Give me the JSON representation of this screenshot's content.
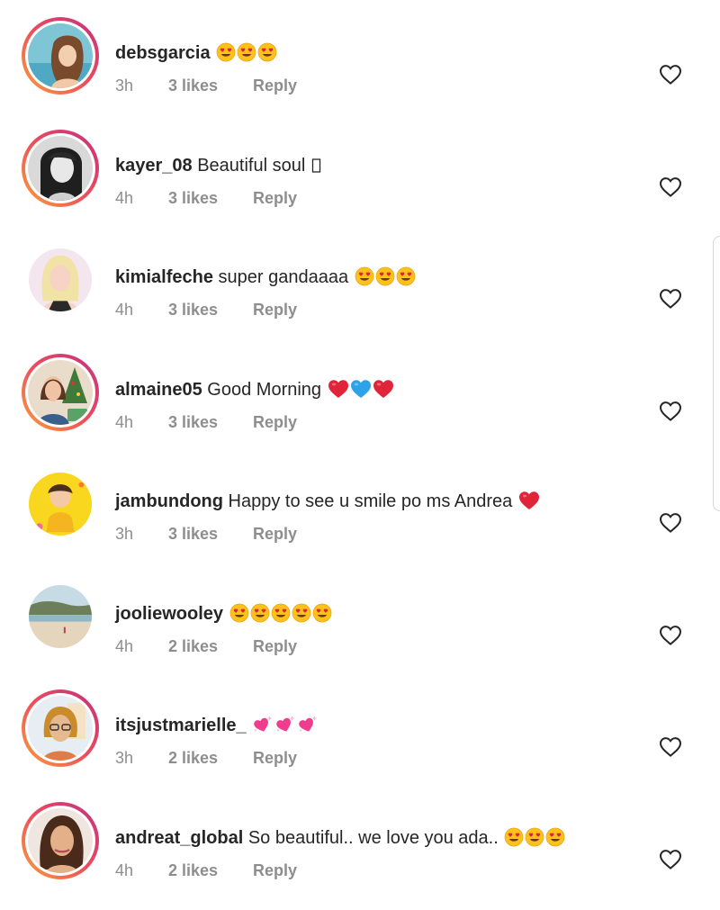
{
  "comments": [
    {
      "username": "debsgarcia",
      "text": "",
      "emoji": [
        "heart-eyes",
        "heart-eyes",
        "heart-eyes"
      ],
      "time": "3h",
      "likes": "3 likes",
      "reply_label": "Reply",
      "story_ring": true,
      "avatar_icon": "avatar-woman-pool-photo"
    },
    {
      "username": "kayer_08",
      "text": "Beautiful soul ",
      "emoji": [
        "missing-glyph"
      ],
      "time": "4h",
      "likes": "3 likes",
      "reply_label": "Reply",
      "story_ring": true,
      "avatar_icon": "avatar-woman-bw-photo"
    },
    {
      "username": "kimialfeche",
      "text": "super gandaaaa ",
      "emoji": [
        "heart-eyes",
        "heart-eyes",
        "heart-eyes"
      ],
      "time": "4h",
      "likes": "3 likes",
      "reply_label": "Reply",
      "story_ring": false,
      "avatar_icon": "avatar-blonde-woman-photo"
    },
    {
      "username": "almaine05",
      "text": "Good Morning ",
      "emoji": [
        "red-heart",
        "blue-heart",
        "red-heart"
      ],
      "time": "4h",
      "likes": "3 likes",
      "reply_label": "Reply",
      "story_ring": true,
      "avatar_icon": "avatar-woman-christmas-photo"
    },
    {
      "username": "jambundong",
      "text": "Happy to see u smile po ms Andrea ",
      "emoji": [
        "red-heart"
      ],
      "time": "3h",
      "likes": "3 likes",
      "reply_label": "Reply",
      "story_ring": false,
      "avatar_icon": "avatar-child-yellow-photo"
    },
    {
      "username": "jooliewooley",
      "text": "",
      "emoji": [
        "heart-eyes",
        "heart-eyes",
        "heart-eyes",
        "heart-eyes",
        "heart-eyes"
      ],
      "time": "4h",
      "likes": "2 likes",
      "reply_label": "Reply",
      "story_ring": false,
      "avatar_icon": "avatar-beach-photo"
    },
    {
      "username": "itsjustmarielle_",
      "text": "",
      "emoji": [
        "sparkling-hearts",
        "sparkling-hearts",
        "sparkling-hearts"
      ],
      "time": "3h",
      "likes": "2 likes",
      "reply_label": "Reply",
      "story_ring": true,
      "avatar_icon": "avatar-woman-glasses-photo"
    },
    {
      "username": "andreat_global",
      "text": "So beautiful.. we love you ada.. ",
      "emoji": [
        "heart-eyes",
        "heart-eyes",
        "heart-eyes"
      ],
      "time": "4h",
      "likes": "2 likes",
      "reply_label": "Reply",
      "story_ring": true,
      "avatar_icon": "avatar-woman-portrait-photo"
    }
  ],
  "colors": {
    "text_primary": "#262626",
    "text_secondary": "#8e8e8e",
    "story_ring_start": "#f9a23a",
    "story_ring_mid": "#ee4b5d",
    "story_ring_end": "#c2307e",
    "emoji_face": "#fcc21b",
    "emoji_heart_red": "#e0243a",
    "emoji_heart_blue": "#2ca3e8",
    "emoji_heart_pink": "#f03c8c"
  },
  "icons": {
    "like": "heart-outline-icon"
  }
}
